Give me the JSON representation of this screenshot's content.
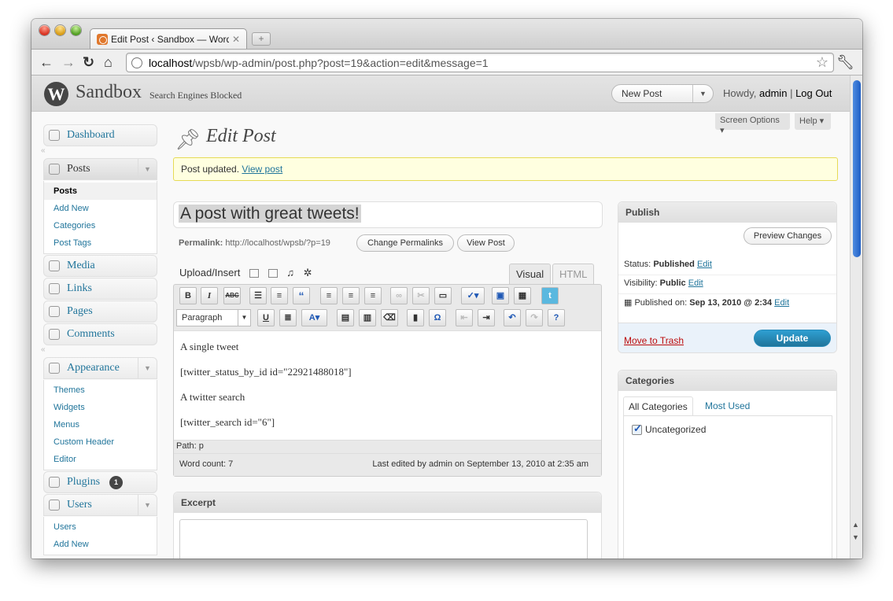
{
  "browser": {
    "tab_title": "Edit Post ‹ Sandbox — WordP",
    "tab_close": "✕",
    "new_tab": "+",
    "url_host": "localhost",
    "url_path": "/wpsb/wp-admin/post.php?post=19&action=edit&message=1"
  },
  "wp_header": {
    "logo": "W",
    "site_title": "Sandbox",
    "site_subtitle": "Search Engines Blocked",
    "favorite_action": "New Post",
    "howdy_prefix": "Howdy,",
    "user": "admin",
    "separator": "|",
    "logout": "Log Out"
  },
  "screen_meta": {
    "screen_options": "Screen Options ▾",
    "help": "Help ▾"
  },
  "menu": {
    "dashboard": "Dashboard",
    "posts": "Posts",
    "posts_sub": [
      "Posts",
      "Add New",
      "Categories",
      "Post Tags"
    ],
    "media": "Media",
    "links": "Links",
    "pages": "Pages",
    "comments": "Comments",
    "appearance": "Appearance",
    "appearance_sub": [
      "Themes",
      "Widgets",
      "Menus",
      "Custom Header",
      "Editor"
    ],
    "plugins": "Plugins",
    "plugins_badge": "1",
    "users": "Users",
    "users_sub": [
      "Users",
      "Add New"
    ]
  },
  "page": {
    "title": "Edit Post",
    "notice_text": "Post updated.",
    "notice_link": "View post"
  },
  "post": {
    "title": "A post with great tweets!",
    "permalink_label": "Permalink:",
    "permalink_url": "http://localhost/wpsb/?p=19",
    "change_permalinks": "Change Permalinks",
    "view_post": "View Post"
  },
  "editor": {
    "upload_insert": "Upload/Insert",
    "tab_visual": "Visual",
    "tab_html": "HTML",
    "format_select": "Paragraph",
    "content": [
      "A single tweet",
      "[twitter_status_by_id id=\"22921488018\"]",
      "A twitter search",
      "[twitter_search id=\"6\"]"
    ],
    "path": "Path: p",
    "word_count": "Word count: 7",
    "last_edited": "Last edited by admin on September 13, 2010 at 2:35 am"
  },
  "excerpt": {
    "heading": "Excerpt"
  },
  "publish": {
    "heading": "Publish",
    "preview_button": "Preview Changes",
    "status_label": "Status:",
    "status_value": "Published",
    "visibility_label": "Visibility:",
    "visibility_value": "Public",
    "published_label": "Published on:",
    "published_value": "Sep 13, 2010 @ 2:34",
    "edit_link": "Edit",
    "trash": "Move to Trash",
    "update": "Update"
  },
  "categories": {
    "heading": "Categories",
    "tab_all": "All Categories",
    "tab_most_used": "Most Used",
    "items": [
      "Uncategorized"
    ]
  }
}
